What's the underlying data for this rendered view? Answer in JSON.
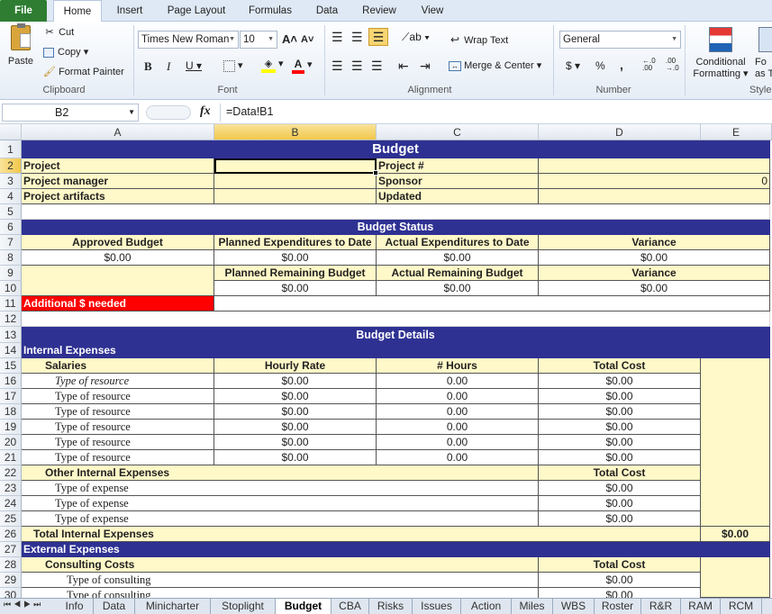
{
  "ribbon": {
    "tabs": [
      "File",
      "Home",
      "Insert",
      "Page Layout",
      "Formulas",
      "Data",
      "Review",
      "View"
    ],
    "clipboard": {
      "paste": "Paste",
      "cut": "Cut",
      "copy": "Copy",
      "format_painter": "Format Painter",
      "label": "Clipboard"
    },
    "font": {
      "name": "Times New Roman",
      "size": "10",
      "label": "Font"
    },
    "alignment": {
      "wrap": "Wrap Text",
      "merge": "Merge & Center",
      "label": "Alignment"
    },
    "number": {
      "format": "General",
      "label": "Number",
      "currency": "$",
      "percent": "%",
      "comma": ","
    },
    "styles": {
      "conditional_1": "Conditional",
      "conditional_2": "Formatting",
      "format_1": "Fo",
      "format_2": "as T",
      "label": "Style"
    }
  },
  "formula_bar": {
    "name_box": "B2",
    "fx": "fx",
    "formula": "=Data!B1"
  },
  "columns": [
    "A",
    "B",
    "C",
    "D",
    "E"
  ],
  "rows": [
    "1",
    "2",
    "3",
    "4",
    "5",
    "6",
    "7",
    "8",
    "9",
    "10",
    "11",
    "12",
    "13",
    "14",
    "15",
    "16",
    "17",
    "18",
    "19",
    "20",
    "21",
    "22",
    "23",
    "24",
    "25",
    "26",
    "27",
    "28",
    "29",
    "30"
  ],
  "sheet": {
    "title": "Budget",
    "project": "Project",
    "project_manager": "Project manager",
    "project_artifacts": "Project artifacts",
    "project_no": "Project #",
    "sponsor": "Sponsor",
    "updated": "Updated",
    "sponsor_value": "0",
    "status_title": "Budget Status",
    "approved_budget": "Approved Budget",
    "planned_exp": "Planned Expenditures to Date",
    "actual_exp": "Actual Expenditures to Date",
    "variance": "Variance",
    "planned_remaining": "Planned Remaining Budget",
    "actual_remaining": "Actual Remaining Budget",
    "zero": "$0.00",
    "zero_hours": "0.00",
    "additional": "Additional $ needed",
    "details_title": "Budget Details",
    "internal": "Internal Expenses",
    "salaries": "Salaries",
    "hourly_rate": "Hourly Rate",
    "hours": "# Hours",
    "total_cost": "Total Cost",
    "type_resource": "Type of resource",
    "other_internal": "Other Internal Expenses",
    "type_expense": "Type of expense",
    "total_internal": "Total Internal Expenses",
    "external": "External Expenses",
    "consulting": "Consulting Costs",
    "type_consulting": "Type of consulting"
  },
  "sheet_tabs": [
    "Info",
    "Data",
    "Minicharter",
    "Stoplight",
    "Budget",
    "CBA",
    "Risks",
    "Issues",
    "Action",
    "Miles",
    "WBS",
    "Roster",
    "R&R",
    "RAM",
    "RCM"
  ],
  "colors": {
    "band": "#2e3192",
    "cell_fill": "#fff8c8",
    "alert": "#ff0000",
    "file_tab": "#2e7d32"
  }
}
